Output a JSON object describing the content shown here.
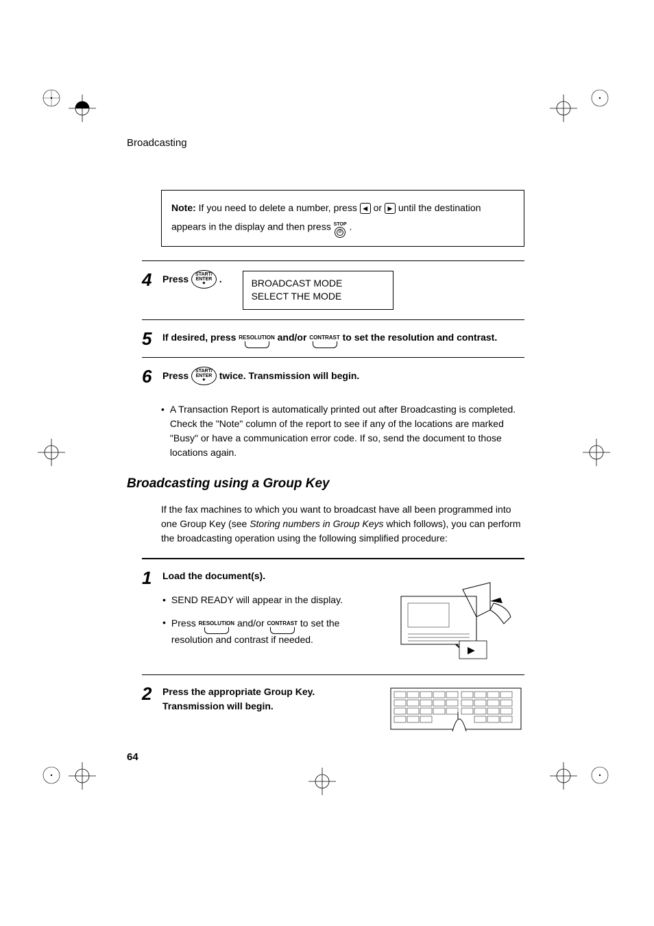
{
  "header": {
    "title": "Broadcasting"
  },
  "note": {
    "bold": "Note:",
    "part1": " If you need to delete a number, press ",
    "or": " or ",
    "part2": " until the destination appears in the display and then press ",
    "stop_label": "STOP",
    "period": " ."
  },
  "steps_a": {
    "s4": {
      "num": "4",
      "text_a": "Press ",
      "btn": "START/\nENTER",
      "period": ".",
      "display": "BROADCAST MODE\nSELECT THE MODE"
    },
    "s5": {
      "num": "5",
      "text_a": "If desired, press ",
      "key1": "RESOLUTION",
      "mid": " and/or ",
      "key2": "CONTRAST",
      "text_b": " to set the resolution and contrast."
    },
    "s6": {
      "num": "6",
      "text_a": "Press ",
      "btn": "START/\nENTER",
      "text_b": " twice. Transmission will begin."
    },
    "bullet": "A Transaction Report is automatically printed out after Broadcasting is completed. Check the \"Note\" column of the report to see if any of the locations are marked \"Busy\" or have a communication error code. If so, send the document to those locations again."
  },
  "section2": {
    "heading": "Broadcasting using a Group Key",
    "intro_a": "If the fax machines to which you want to broadcast have all been programmed into one Group Key (see ",
    "intro_em": "Storing numbers in Group Keys",
    "intro_b": " which follows), you can perform the broadcasting operation using the following simplified procedure:"
  },
  "steps_b": {
    "s1": {
      "num": "1",
      "title": "Load the document(s).",
      "b1": "SEND READY will appear in the display.",
      "b2a": "Press ",
      "key1": "RESOLUTION",
      "mid": " and/or ",
      "key2": "CONTRAST",
      "b2b": " to set the resolution and contrast if needed."
    },
    "s2": {
      "num": "2",
      "title": "Press the appropriate Group Key. Transmission will begin."
    }
  },
  "page_number": "64",
  "icons": {
    "left_arrow": "◀",
    "right_arrow": "▶",
    "stop_glyph": "⦸"
  }
}
